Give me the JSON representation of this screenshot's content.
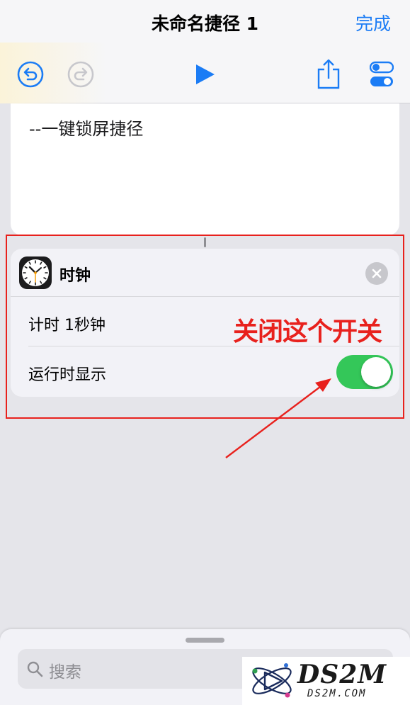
{
  "nav": {
    "title": "未命名捷径 1",
    "done_label": "完成",
    "icons": [
      "undo-icon",
      "redo-icon",
      "play-icon",
      "share-icon",
      "settings-toggle-icon"
    ],
    "accent_color": "#1b7cf5"
  },
  "shortcut_text": {
    "body": "--一键锁屏捷径"
  },
  "action_card": {
    "app_name": "时钟",
    "app_icon": "clock-app-icon",
    "remove_icon": "close-icon",
    "param_row": "计时 1秒钟",
    "toggle_row": {
      "label": "运行时显示",
      "on": true,
      "on_color": "#34c759"
    }
  },
  "annotation": {
    "text": "关闭这个开关",
    "color": "#e8211d"
  },
  "bottom_sheet": {
    "search_placeholder": "搜索",
    "search_icon": "search-icon"
  },
  "watermark": {
    "brand": "DS2M",
    "url": "DS2M.COM"
  }
}
